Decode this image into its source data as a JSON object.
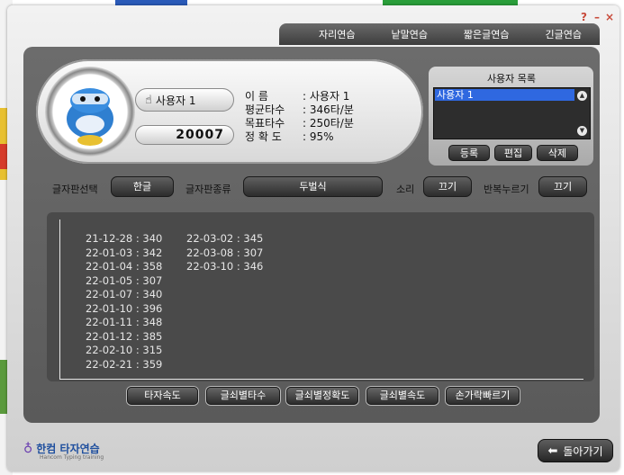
{
  "window": {
    "controls": {
      "help": "?",
      "minimize": "–",
      "close": "×"
    }
  },
  "tabs": [
    "자리연습",
    "낱말연습",
    "짧은글연습",
    "긴글연습"
  ],
  "profile": {
    "name_badge": "사용자 1",
    "score": "20007",
    "info": [
      {
        "label": "이    름",
        "value": ": 사용자 1"
      },
      {
        "label": "평균타수",
        "value": ": 346타/분"
      },
      {
        "label": "목표타수",
        "value": ": 250타/분"
      },
      {
        "label": "정 확 도",
        "value": ": 95%"
      }
    ]
  },
  "user_list": {
    "title": "사용자 목록",
    "items": [
      "사용자 1"
    ],
    "selected": "사용자 1",
    "buttons": {
      "register": "등록",
      "edit": "편집",
      "delete": "삭제"
    }
  },
  "options": {
    "keyboard_select_label": "글자판선택",
    "keyboard_select_value": "한글",
    "keyboard_type_label": "글자판종류",
    "keyboard_type_value": "두벌식",
    "sound_label": "소리",
    "sound_value": "끄기",
    "repeat_label": "반복누르기",
    "repeat_value": "끄기"
  },
  "records": {
    "column1": [
      "21-12-28 : 340",
      "22-01-03 : 342",
      "22-01-04 : 358",
      "22-01-05 : 307",
      "22-01-07 : 340",
      "22-01-10 : 396",
      "22-01-11 : 348",
      "22-01-12 : 385",
      "22-02-10 : 315",
      "22-02-21 : 359"
    ],
    "column2": [
      "22-03-02 : 345",
      "22-03-08 : 307",
      "22-03-10 : 346"
    ]
  },
  "bottom_buttons": [
    "타자속도",
    "글쇠별타수",
    "글쇠별정확도",
    "글쇠별속도",
    "손가락빠르기"
  ],
  "footer": {
    "brand": "한컴 타자연습",
    "brand_sub": "Hancom Typing training",
    "back_button": "돌아가기"
  },
  "colors": {
    "accent_select": "#2f68e0",
    "brand": "#1f4f9e"
  }
}
